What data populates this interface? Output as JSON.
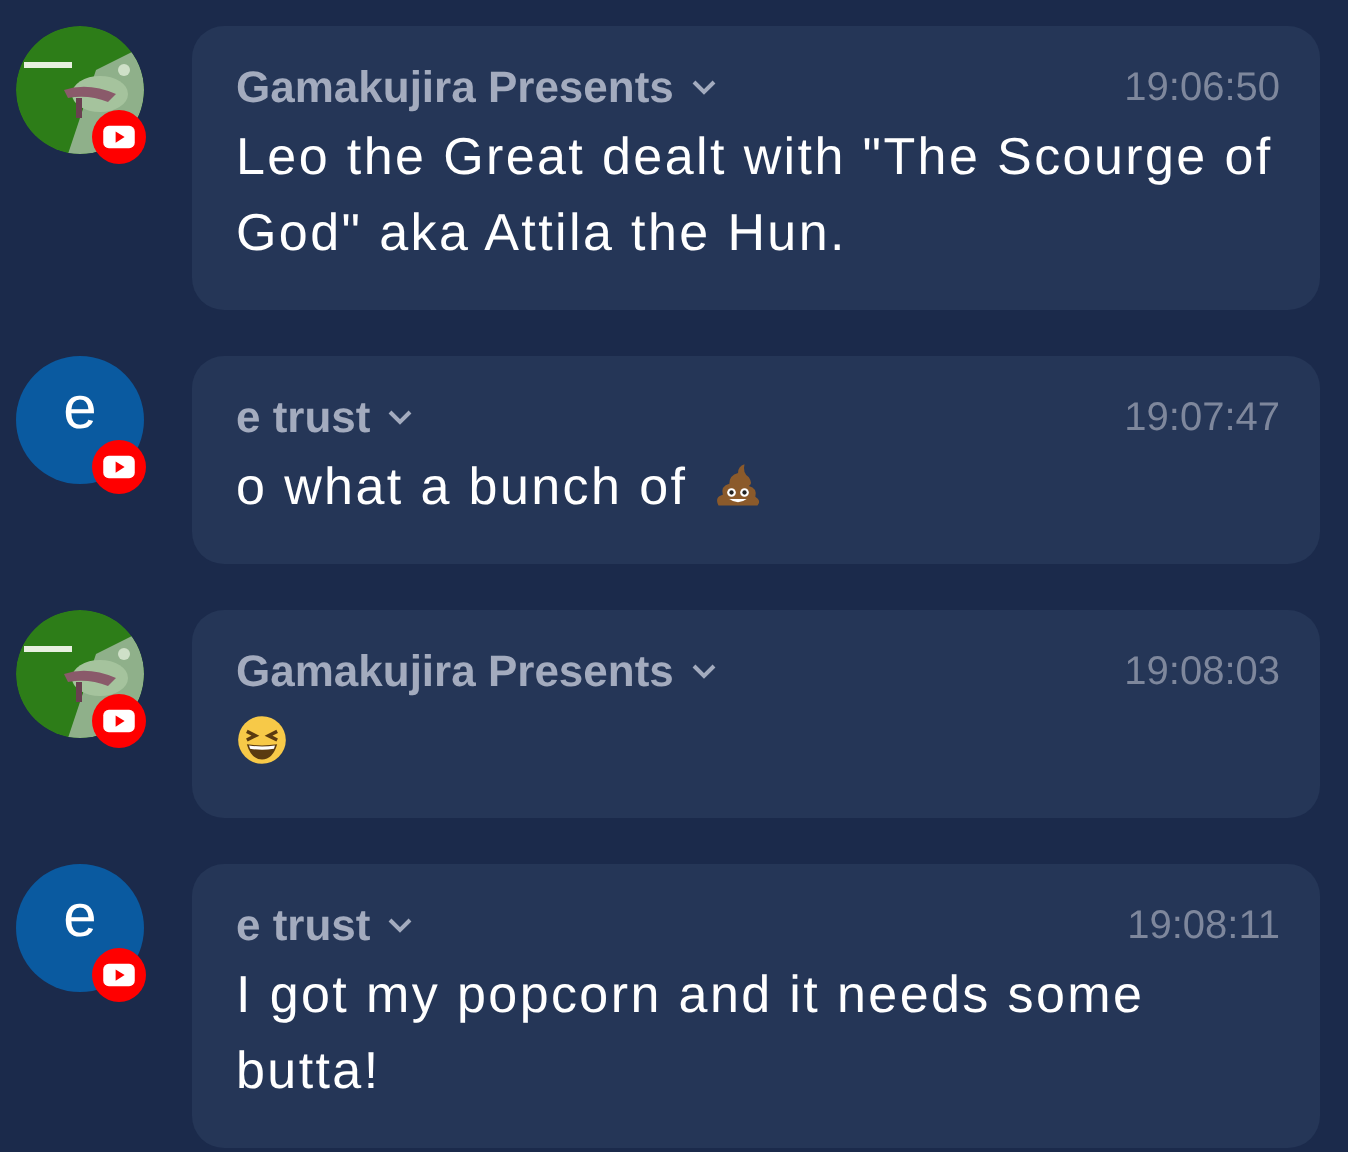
{
  "messages": [
    {
      "author": "Gamakujira Presents",
      "time": "19:06:50",
      "text": "Leo the Great dealt with \"The Scourge of God\" aka Attila the Hun."
    },
    {
      "author": "e trust",
      "time": "19:07:47",
      "avatar": {
        "kind": "letter",
        "letter": "e"
      },
      "text": "o what a bunch of",
      "emoji": {
        "kind": "poop"
      }
    },
    {
      "author": "Gamakujira Presents",
      "time": "19:08:03",
      "emoji": {
        "kind": "laughing"
      }
    },
    {
      "author": "e trust",
      "time": "19:08:11",
      "avatar": {
        "kind": "letter",
        "letter": "e"
      },
      "text": "I got my popcorn and it needs some butta!"
    }
  ]
}
